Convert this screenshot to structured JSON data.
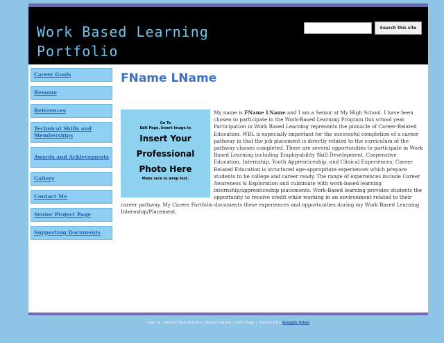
{
  "header": {
    "title": "Work Based Learning Portfolio",
    "search_placeholder": "",
    "search_button": "Search this site"
  },
  "sidebar": {
    "items": [
      {
        "label": "Career Goals"
      },
      {
        "label": "Resume"
      },
      {
        "label": "References"
      },
      {
        "label": "Technical Skills and Memberships"
      },
      {
        "label": "Awards and Achievements"
      },
      {
        "label": "Gallery"
      },
      {
        "label": "Contact Me"
      },
      {
        "label": "Senior Project Page"
      },
      {
        "label": "Supporting Documents"
      }
    ]
  },
  "main": {
    "title": "FName LName",
    "photo": {
      "line1": "Go To",
      "line2": "Edit Page, Insert Image to",
      "line3": "Insert Your",
      "line4": "Professional",
      "line5": "Photo Here",
      "line6": "Make sure to wrap text."
    },
    "intro_before": "My name is ",
    "intro_name": "FName LName",
    "intro_after": " and I am a Senior at My High School. I have been chosen to participate in the Work-Based Learning Program this school year.  Participation in Work Based Learning represents the pinnacle of Career-Related Education.  WBL is especially important for the successful completion of a career pathway in that the job placement is directly related to the curriculum of the pathway classes completed.  There are several opportunities to participate in Work Based Learning including Employability Skill Development, Cooperative Education, Internship, Youth Apprenticeship, and Clinical Experiences.  Career Related Education is structured age-appropriate experiences which prepare students to be college and career ready.  The range of experiences include Career Awareness & Exploration and culminate with work-based learning internship/apprenticeship placements.  Work-Based learning provides students the opportunity to receive credit while working in an environment related to their career pathway.  My Career Portfolio documents these experiences and opportunities during my Work Based Learning Internship/Placement."
  },
  "footer": {
    "links": [
      "Sign in",
      "Recent Site Activity",
      "Report Abuse",
      "Print Page"
    ],
    "separator": "|",
    "powered_by": "Powered By",
    "google_sites": "Google Sites"
  },
  "colors": {
    "background": "#8ec4e6",
    "header": "#000000",
    "title": "#6fc3ee",
    "accent_rule": "#6f68b6",
    "nav_item": "#8ecff3",
    "heading": "#3d73c6"
  }
}
